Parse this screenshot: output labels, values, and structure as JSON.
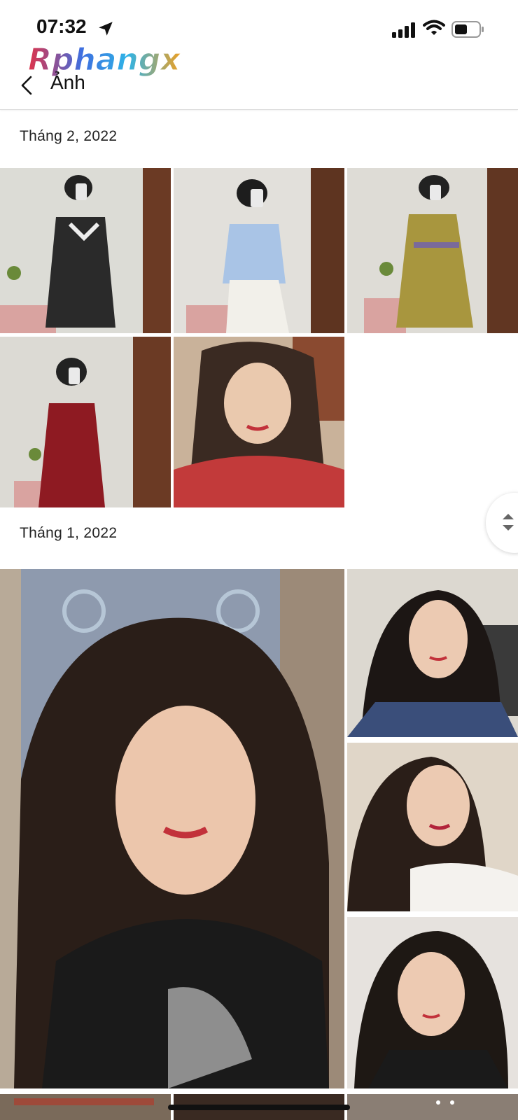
{
  "status_bar": {
    "time": "07:32",
    "battery_level": 0.5
  },
  "watermark": {
    "text": "Rphangx"
  },
  "header": {
    "title": "Ảnh"
  },
  "sections": [
    {
      "title": "Tháng 2, 2022"
    },
    {
      "title": "Tháng 1, 2022"
    }
  ],
  "colors": {
    "accent": "#111111",
    "divider": "#dcdcdc",
    "background": "#ffffff"
  }
}
